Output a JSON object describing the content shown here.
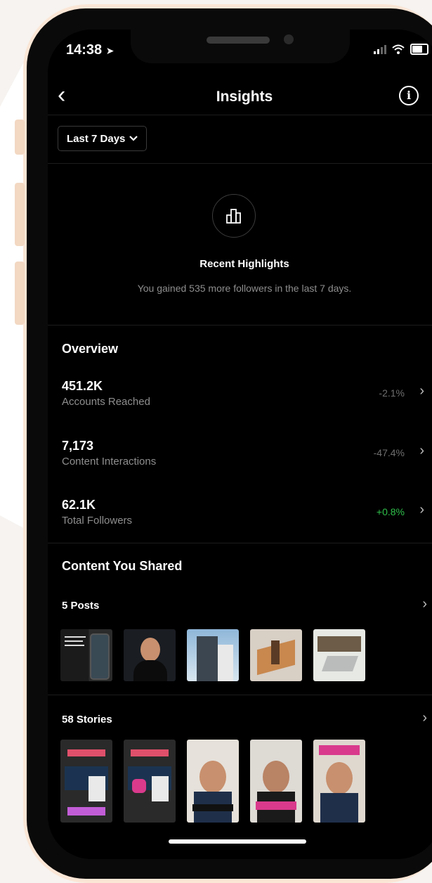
{
  "status_bar": {
    "time": "14:38"
  },
  "header": {
    "title": "Insights"
  },
  "filter": {
    "label": "Last 7 Days"
  },
  "highlights": {
    "title": "Recent Highlights",
    "subtitle": "You gained 535 more followers in the last 7 days."
  },
  "overview": {
    "title": "Overview",
    "metrics": [
      {
        "value": "451.2K",
        "label": "Accounts Reached",
        "change": "-2.1%"
      },
      {
        "value": "7,173",
        "label": "Content Interactions",
        "change": "-47.4%"
      },
      {
        "value": "62.1K",
        "label": "Total Followers",
        "change": "+0.8%"
      }
    ]
  },
  "content_shared": {
    "title": "Content You Shared",
    "posts_label": "5 Posts",
    "stories_label": "58 Stories"
  },
  "colors": {
    "positive": "#2fbf4a",
    "background": "#000000",
    "muted_text": "#8e8e8e"
  },
  "icons": [
    "back-chevron-icon",
    "info-icon",
    "chevron-down-icon",
    "bar-chart-icon",
    "chevron-right-icon"
  ]
}
